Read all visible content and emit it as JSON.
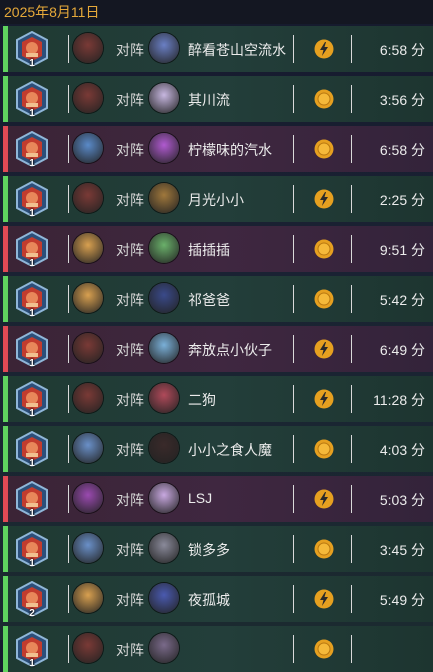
{
  "date": "2025年8月11日",
  "vs_label": "对阵",
  "matches": [
    {
      "result": "win",
      "rank": "1",
      "my_avatar": "#7a3a36",
      "opp_avatar": "#6a7fc4",
      "opponent": "醉看苍山空流水",
      "icon": "bolt",
      "duration": "6:58 分"
    },
    {
      "result": "win",
      "rank": "1",
      "my_avatar": "#7a3a36",
      "opp_avatar": "#c7b7e0",
      "opponent": "其川流",
      "icon": "coin",
      "duration": "3:56 分"
    },
    {
      "result": "loss",
      "rank": "1",
      "my_avatar": "#5a8ac8",
      "opp_avatar": "#b05ad0",
      "opponent": "柠檬味的汽水",
      "icon": "coin",
      "duration": "6:58 分"
    },
    {
      "result": "win",
      "rank": "1",
      "my_avatar": "#7a3a36",
      "opp_avatar": "#a0783c",
      "opponent": "月光小小",
      "icon": "bolt",
      "duration": "2:25 分"
    },
    {
      "result": "loss",
      "rank": "1",
      "my_avatar": "#d8a050",
      "opp_avatar": "#6ab06a",
      "opponent": "插插插",
      "icon": "coin",
      "duration": "9:51 分"
    },
    {
      "result": "win",
      "rank": "1",
      "my_avatar": "#d8a050",
      "opp_avatar": "#3a4a8a",
      "opponent": "祁爸爸",
      "icon": "coin",
      "duration": "5:42 分"
    },
    {
      "result": "loss",
      "rank": "1",
      "my_avatar": "#7a3a36",
      "opp_avatar": "#7ab0d8",
      "opponent": "奔放点小伙子",
      "icon": "bolt",
      "duration": "6:49 分"
    },
    {
      "result": "win",
      "rank": "1",
      "my_avatar": "#7a3a36",
      "opp_avatar": "#b04a5a",
      "opponent": "二狗",
      "icon": "bolt",
      "duration": "11:28 分"
    },
    {
      "result": "win",
      "rank": "1",
      "my_avatar": "#6a90c8",
      "opp_avatar": "#3a2a2a",
      "opponent": "小小之食人魔",
      "icon": "coin",
      "duration": "4:03 分"
    },
    {
      "result": "loss",
      "rank": "1",
      "my_avatar": "#9a4ab0",
      "opp_avatar": "#c8a8e0",
      "opponent": "LSJ",
      "icon": "bolt",
      "duration": "5:03 分"
    },
    {
      "result": "win",
      "rank": "1",
      "my_avatar": "#6a90c8",
      "opp_avatar": "#8a8a9a",
      "opponent": "锁多多",
      "icon": "coin",
      "duration": "3:45 分"
    },
    {
      "result": "win",
      "rank": "2",
      "my_avatar": "#d8a050",
      "opp_avatar": "#4a5ab0",
      "opponent": "夜孤城",
      "icon": "bolt",
      "duration": "5:49 分"
    },
    {
      "result": "win",
      "rank": "1",
      "my_avatar": "#7a3a36",
      "opp_avatar": "#7a6a8a",
      "opponent": "",
      "icon": "coin",
      "duration": ""
    }
  ],
  "colors": {
    "win": "#5fd35f",
    "loss": "#e14a55",
    "date": "#e6a93a",
    "icon": "#e6a020"
  }
}
